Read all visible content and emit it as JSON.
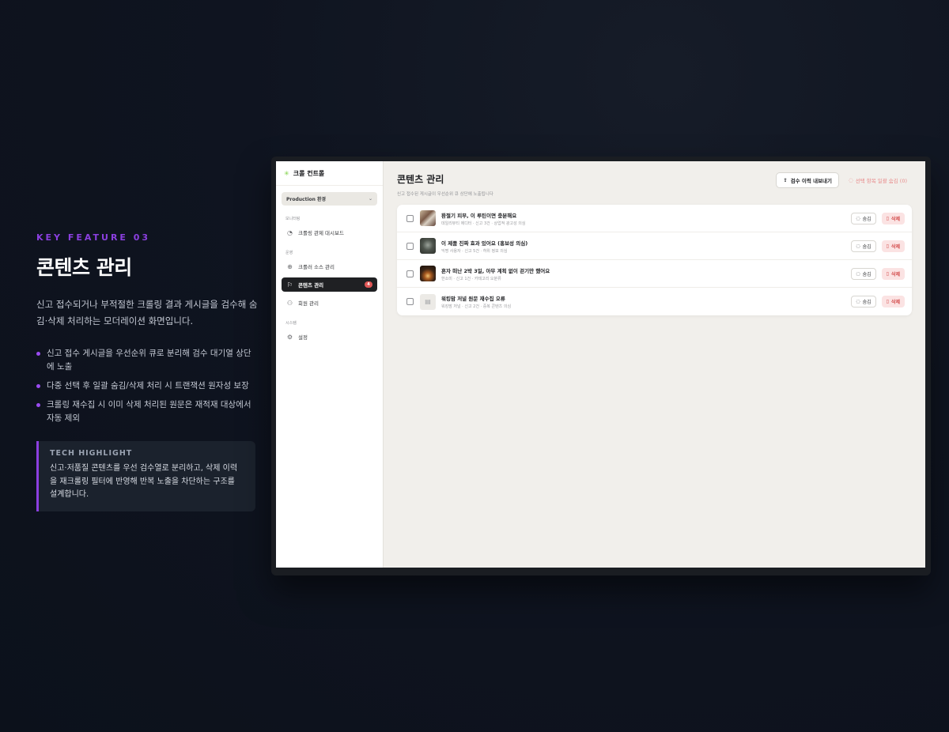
{
  "feature": {
    "kicker": "KEY FEATURE 03",
    "title": "콘텐츠 관리",
    "description": "신고 접수되거나 부적절한 크롤링 결과 게시글을 검수해 숨김·삭제 처리하는 모더레이션 화면입니다.",
    "bullets": [
      "신고 접수 게시글을 우선순위 큐로 분리해 검수 대기열 상단에 노출",
      "다중 선택 후 일괄 숨김/삭제 처리 시 트랜잭션 원자성 보장",
      "크롤링 재수집 시 이미 삭제 처리된 원문은 재적재 대상에서 자동 제외"
    ],
    "highlight": {
      "title": "TECH HIGHLIGHT",
      "body": "신고·저품질 콘텐츠를 우선 검수열로 분리하고, 삭제 이력을 재크롤링 필터에 반영해 반복 노출을 차단하는 구조를 설계합니다."
    }
  },
  "app": {
    "brand": "크롤 컨트롤",
    "env": "Production 환경",
    "sections": [
      {
        "label": "모니터링",
        "items": [
          {
            "label": "크롤링 관제 대시보드",
            "icon": "gauge-icon"
          }
        ]
      },
      {
        "label": "운영",
        "items": [
          {
            "label": "크롤러 소스 관리",
            "icon": "globe-icon"
          },
          {
            "label": "콘텐츠 관리",
            "icon": "flag-icon",
            "badge": "4",
            "active": true
          },
          {
            "label": "회원 관리",
            "icon": "users-icon"
          }
        ]
      },
      {
        "label": "시스템",
        "items": [
          {
            "label": "설정",
            "icon": "gear-icon"
          }
        ]
      }
    ],
    "main": {
      "title": "콘텐츠 관리",
      "subtitle": "신고 접수된 게시글이 우선순위 큐 상단에 노출됩니다",
      "export_label": "검수 이력 내보내기",
      "bulk_hide_label": "선택 항목 일괄 숨김 (0)",
      "hide_label": "숨김",
      "delete_label": "삭제",
      "rows": [
        {
          "title": "환절기 피부, 이 루틴이면 충분해요",
          "meta": "데일리뷰티 에디터 · 신고 3건 · 상업적 광고성 의심"
        },
        {
          "title": "이 제품 진짜 효과 있어요 (홍보성 의심)",
          "meta": "익명 사용자 · 신고 5건 · 허위 정보 의심"
        },
        {
          "title": "혼자 떠난 2박 3일, 아무 계획 없이 걷기만 했어요",
          "meta": "한소미 · 신고 1건 · 카테고리 오분류"
        },
        {
          "title": "워킹맘 저널 원문 재수집 오류",
          "meta": "워킹맘 저널 · 신고 2건 · 중복 콘텐츠 의심"
        }
      ]
    }
  }
}
